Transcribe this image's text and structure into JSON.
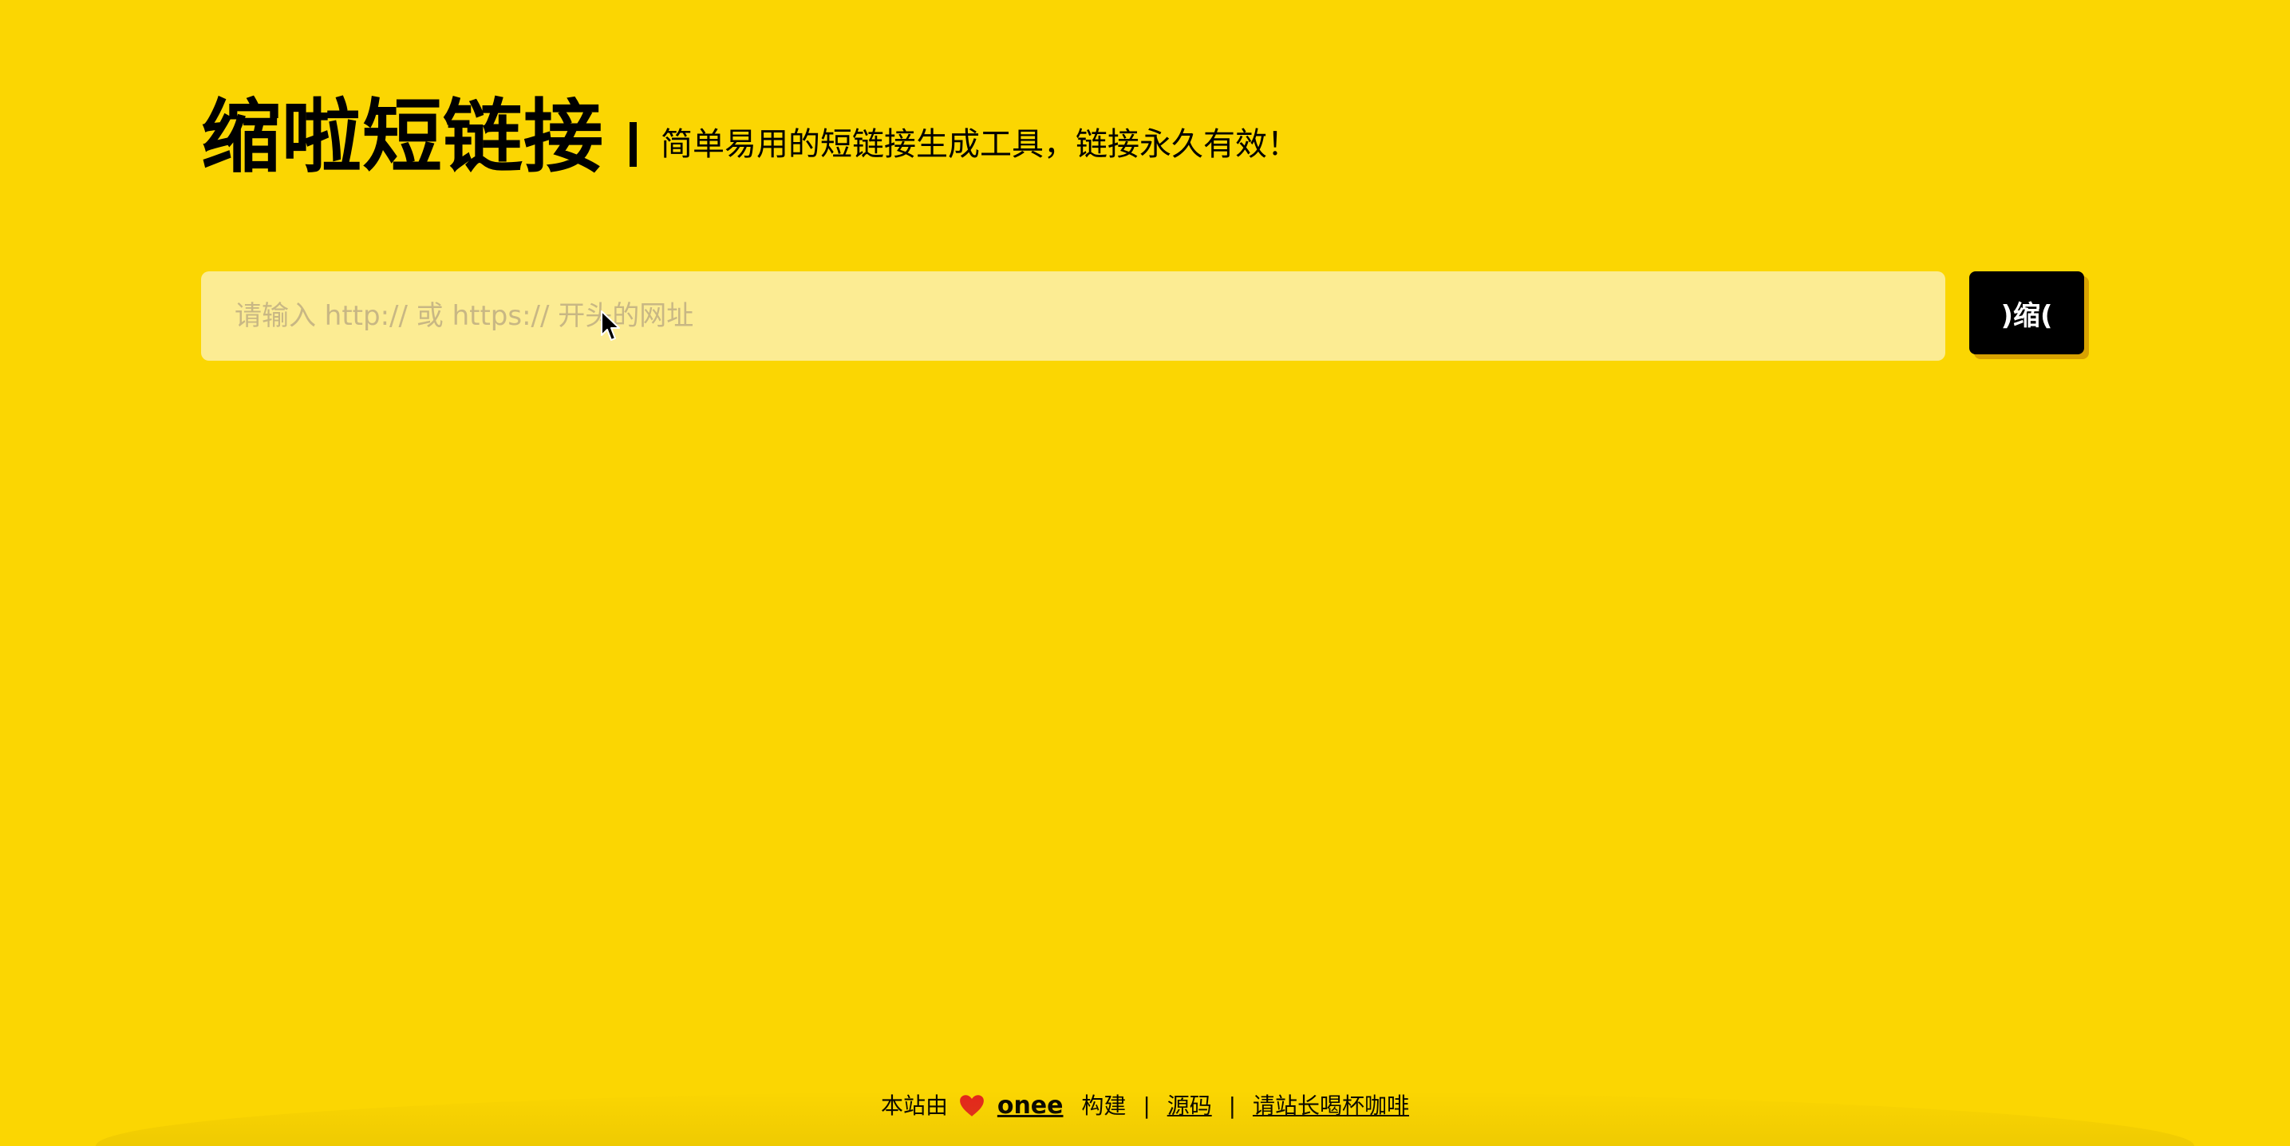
{
  "header": {
    "title": "缩啦短链接",
    "tagline": "简单易用的短链接生成工具，链接永久有效！"
  },
  "form": {
    "url_value": "",
    "url_placeholder": "请输入 http:// 或 https:// 开头的网址",
    "submit_label": ")缩("
  },
  "footer": {
    "built_prefix": "本站由",
    "heart_icon": "heart-icon",
    "author_link": "onee",
    "built_suffix": "构建",
    "source_link": "源码",
    "coffee_link": "请站长喝杯咖啡"
  },
  "colors": {
    "background": "#fbd602",
    "input_background": "#fcec93",
    "button_background": "#000000",
    "button_text": "#ffffff",
    "heart": "#e3251d"
  }
}
